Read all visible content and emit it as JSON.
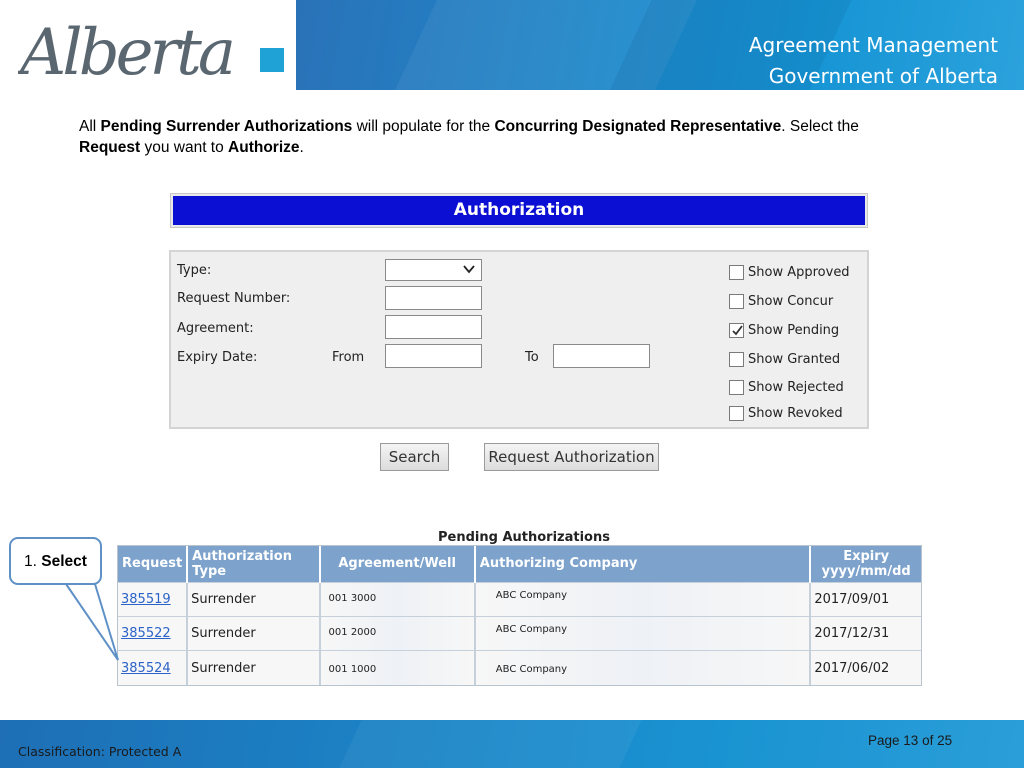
{
  "header": {
    "logo_text": "Alberta",
    "title_line1": "Agreement Management",
    "title_line2": "Government of Alberta"
  },
  "instructions": {
    "t1": "All ",
    "b1": "Pending Surrender Authorizations",
    "t2": " will populate for the ",
    "b2": "Concurring Designated Representative",
    "t3": ".  Select the ",
    "b3": "Request",
    "t4": " you want to ",
    "b4": "Authorize",
    "t5": "."
  },
  "form": {
    "title": "Authorization",
    "type_label": "Type:",
    "type_value": "",
    "request_number_label": "Request Number:",
    "request_number_value": "",
    "agreement_label": "Agreement:",
    "agreement_value": "",
    "expiry_label": "Expiry Date:",
    "from_label": "From",
    "from_value": "",
    "to_label": "To",
    "to_value": "",
    "checkboxes": [
      {
        "label": "Show Approved",
        "checked": false
      },
      {
        "label": "Show Concur",
        "checked": false
      },
      {
        "label": "Show Pending",
        "checked": true
      },
      {
        "label": "Show Granted",
        "checked": false
      },
      {
        "label": "Show Rejected",
        "checked": false
      },
      {
        "label": "Show Revoked",
        "checked": false
      }
    ],
    "search_button": "Search",
    "request_auth_button": "Request Authorization"
  },
  "pending": {
    "title": "Pending Authorizations",
    "headers": {
      "request": "Request",
      "auth_type_1": "Authorization",
      "auth_type_2": "Type",
      "agreement": "Agreement/Well",
      "company": "Authorizing Company",
      "expiry_1": "Expiry",
      "expiry_2": "yyyy/mm/dd"
    },
    "rows": [
      {
        "request": "385519",
        "type": "Surrender",
        "agreement": "001 3000",
        "company": "ABC Company",
        "expiry": "2017/09/01"
      },
      {
        "request": "385522",
        "type": "Surrender",
        "agreement": "001 2000",
        "company": "ABC Company",
        "expiry": "2017/12/31"
      },
      {
        "request": "385524",
        "type": "Surrender",
        "agreement": "001 1000",
        "company": "ABC Company",
        "expiry": "2017/06/02"
      }
    ]
  },
  "callout": {
    "number": "1. ",
    "label": "Select"
  },
  "footer": {
    "classification": "Classification: Protected A",
    "page_label": "Page ",
    "page_current": "13",
    "page_of": " of ",
    "page_total": "25"
  },
  "colors": {
    "brand_blue": "#1f86c8",
    "title_bar": "#0b0fd4",
    "table_header": "#7da2cc",
    "link": "#2c63c8"
  }
}
